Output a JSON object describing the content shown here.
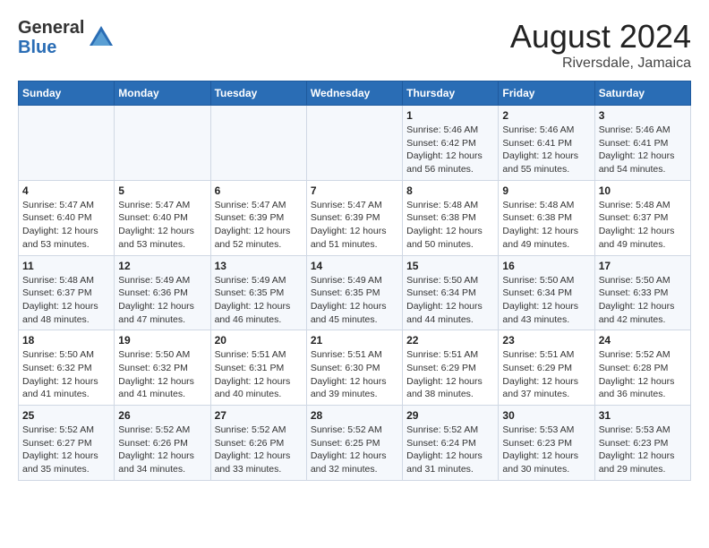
{
  "logo": {
    "general": "General",
    "blue": "Blue"
  },
  "title": "August 2024",
  "subtitle": "Riversdale, Jamaica",
  "days_of_week": [
    "Sunday",
    "Monday",
    "Tuesday",
    "Wednesday",
    "Thursday",
    "Friday",
    "Saturday"
  ],
  "weeks": [
    [
      {
        "day": "",
        "info": ""
      },
      {
        "day": "",
        "info": ""
      },
      {
        "day": "",
        "info": ""
      },
      {
        "day": "",
        "info": ""
      },
      {
        "day": "1",
        "info": "Sunrise: 5:46 AM\nSunset: 6:42 PM\nDaylight: 12 hours\nand 56 minutes."
      },
      {
        "day": "2",
        "info": "Sunrise: 5:46 AM\nSunset: 6:41 PM\nDaylight: 12 hours\nand 55 minutes."
      },
      {
        "day": "3",
        "info": "Sunrise: 5:46 AM\nSunset: 6:41 PM\nDaylight: 12 hours\nand 54 minutes."
      }
    ],
    [
      {
        "day": "4",
        "info": "Sunrise: 5:47 AM\nSunset: 6:40 PM\nDaylight: 12 hours\nand 53 minutes."
      },
      {
        "day": "5",
        "info": "Sunrise: 5:47 AM\nSunset: 6:40 PM\nDaylight: 12 hours\nand 53 minutes."
      },
      {
        "day": "6",
        "info": "Sunrise: 5:47 AM\nSunset: 6:39 PM\nDaylight: 12 hours\nand 52 minutes."
      },
      {
        "day": "7",
        "info": "Sunrise: 5:47 AM\nSunset: 6:39 PM\nDaylight: 12 hours\nand 51 minutes."
      },
      {
        "day": "8",
        "info": "Sunrise: 5:48 AM\nSunset: 6:38 PM\nDaylight: 12 hours\nand 50 minutes."
      },
      {
        "day": "9",
        "info": "Sunrise: 5:48 AM\nSunset: 6:38 PM\nDaylight: 12 hours\nand 49 minutes."
      },
      {
        "day": "10",
        "info": "Sunrise: 5:48 AM\nSunset: 6:37 PM\nDaylight: 12 hours\nand 49 minutes."
      }
    ],
    [
      {
        "day": "11",
        "info": "Sunrise: 5:48 AM\nSunset: 6:37 PM\nDaylight: 12 hours\nand 48 minutes."
      },
      {
        "day": "12",
        "info": "Sunrise: 5:49 AM\nSunset: 6:36 PM\nDaylight: 12 hours\nand 47 minutes."
      },
      {
        "day": "13",
        "info": "Sunrise: 5:49 AM\nSunset: 6:35 PM\nDaylight: 12 hours\nand 46 minutes."
      },
      {
        "day": "14",
        "info": "Sunrise: 5:49 AM\nSunset: 6:35 PM\nDaylight: 12 hours\nand 45 minutes."
      },
      {
        "day": "15",
        "info": "Sunrise: 5:50 AM\nSunset: 6:34 PM\nDaylight: 12 hours\nand 44 minutes."
      },
      {
        "day": "16",
        "info": "Sunrise: 5:50 AM\nSunset: 6:34 PM\nDaylight: 12 hours\nand 43 minutes."
      },
      {
        "day": "17",
        "info": "Sunrise: 5:50 AM\nSunset: 6:33 PM\nDaylight: 12 hours\nand 42 minutes."
      }
    ],
    [
      {
        "day": "18",
        "info": "Sunrise: 5:50 AM\nSunset: 6:32 PM\nDaylight: 12 hours\nand 41 minutes."
      },
      {
        "day": "19",
        "info": "Sunrise: 5:50 AM\nSunset: 6:32 PM\nDaylight: 12 hours\nand 41 minutes."
      },
      {
        "day": "20",
        "info": "Sunrise: 5:51 AM\nSunset: 6:31 PM\nDaylight: 12 hours\nand 40 minutes."
      },
      {
        "day": "21",
        "info": "Sunrise: 5:51 AM\nSunset: 6:30 PM\nDaylight: 12 hours\nand 39 minutes."
      },
      {
        "day": "22",
        "info": "Sunrise: 5:51 AM\nSunset: 6:29 PM\nDaylight: 12 hours\nand 38 minutes."
      },
      {
        "day": "23",
        "info": "Sunrise: 5:51 AM\nSunset: 6:29 PM\nDaylight: 12 hours\nand 37 minutes."
      },
      {
        "day": "24",
        "info": "Sunrise: 5:52 AM\nSunset: 6:28 PM\nDaylight: 12 hours\nand 36 minutes."
      }
    ],
    [
      {
        "day": "25",
        "info": "Sunrise: 5:52 AM\nSunset: 6:27 PM\nDaylight: 12 hours\nand 35 minutes."
      },
      {
        "day": "26",
        "info": "Sunrise: 5:52 AM\nSunset: 6:26 PM\nDaylight: 12 hours\nand 34 minutes."
      },
      {
        "day": "27",
        "info": "Sunrise: 5:52 AM\nSunset: 6:26 PM\nDaylight: 12 hours\nand 33 minutes."
      },
      {
        "day": "28",
        "info": "Sunrise: 5:52 AM\nSunset: 6:25 PM\nDaylight: 12 hours\nand 32 minutes."
      },
      {
        "day": "29",
        "info": "Sunrise: 5:52 AM\nSunset: 6:24 PM\nDaylight: 12 hours\nand 31 minutes."
      },
      {
        "day": "30",
        "info": "Sunrise: 5:53 AM\nSunset: 6:23 PM\nDaylight: 12 hours\nand 30 minutes."
      },
      {
        "day": "31",
        "info": "Sunrise: 5:53 AM\nSunset: 6:23 PM\nDaylight: 12 hours\nand 29 minutes."
      }
    ]
  ]
}
